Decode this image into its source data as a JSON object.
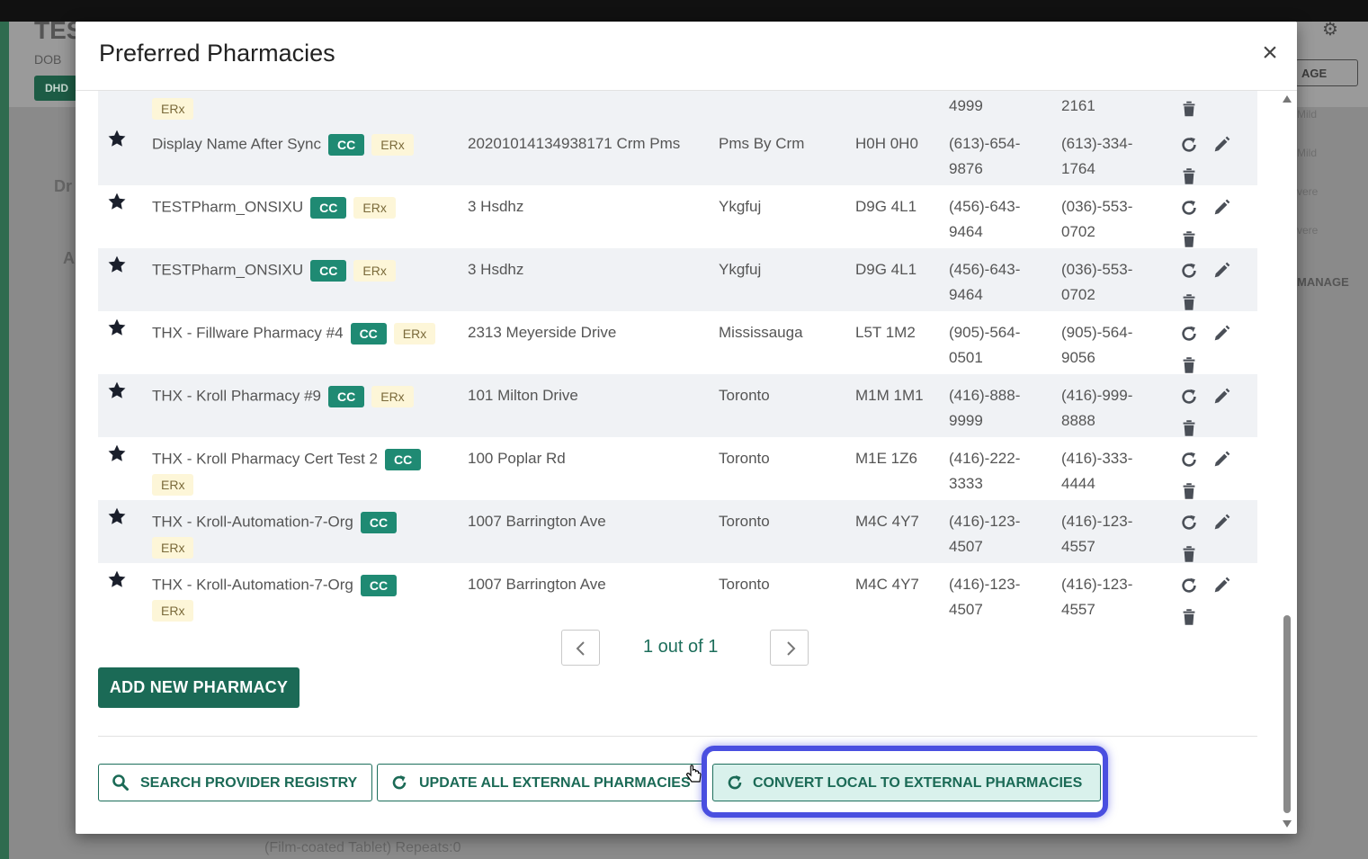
{
  "background": {
    "title": "TES",
    "dob_label": "DOB",
    "chip": "DHD",
    "manage_button": "AGE",
    "severity_labels": [
      "Mild",
      "Mild",
      "vere",
      "vere"
    ],
    "manage_label": "MANAGE",
    "left_texts": [
      "Dr",
      "A"
    ],
    "bottom_text": "(Film-coated Tablet) Repeats:0"
  },
  "modal": {
    "title": "Preferred Pharmacies",
    "close_glyph": "×"
  },
  "partial_row": {
    "erx": "ERx",
    "phone": "4999",
    "fax": "2161"
  },
  "pharmacies": [
    {
      "name": "Display Name After Sync",
      "cc": "CC",
      "erx": "ERx",
      "erx_wrapped": false,
      "address": "20201014134938171 Crm Pms",
      "city": "Pms By Crm",
      "postal": "H0H 0H0",
      "phone_a": "(613)-654-",
      "phone_b": "9876",
      "fax_a": "(613)-334-",
      "fax_b": "1764"
    },
    {
      "name": "TESTPharm_ONSIXU",
      "cc": "CC",
      "erx": "ERx",
      "erx_wrapped": false,
      "address": "3 Hsdhz",
      "city": "Ykgfuj",
      "postal": "D9G 4L1",
      "phone_a": "(456)-643-",
      "phone_b": "9464",
      "fax_a": "(036)-553-",
      "fax_b": "0702"
    },
    {
      "name": "TESTPharm_ONSIXU",
      "cc": "CC",
      "erx": "ERx",
      "erx_wrapped": false,
      "address": "3 Hsdhz",
      "city": "Ykgfuj",
      "postal": "D9G 4L1",
      "phone_a": "(456)-643-",
      "phone_b": "9464",
      "fax_a": "(036)-553-",
      "fax_b": "0702"
    },
    {
      "name": "THX - Fillware Pharmacy #4",
      "cc": "CC",
      "erx": "ERx",
      "erx_wrapped": false,
      "address": "2313 Meyerside Drive",
      "city": "Mississauga",
      "postal": "L5T 1M2",
      "phone_a": "(905)-564-",
      "phone_b": "0501",
      "fax_a": "(905)-564-",
      "fax_b": "9056"
    },
    {
      "name": "THX - Kroll Pharmacy #9",
      "cc": "CC",
      "erx": "ERx",
      "erx_wrapped": false,
      "address": "101 Milton Drive",
      "city": "Toronto",
      "postal": "M1M 1M1",
      "phone_a": "(416)-888-",
      "phone_b": "9999",
      "fax_a": "(416)-999-",
      "fax_b": "8888"
    },
    {
      "name": "THX - Kroll Pharmacy Cert Test 2",
      "cc": "CC",
      "erx": "ERx",
      "erx_wrapped": true,
      "address": "100 Poplar Rd",
      "city": "Toronto",
      "postal": "M1E 1Z6",
      "phone_a": "(416)-222-",
      "phone_b": "3333",
      "fax_a": "(416)-333-",
      "fax_b": "4444"
    },
    {
      "name": "THX - Kroll-Automation-7-Org",
      "cc": "CC",
      "erx": "ERx",
      "erx_wrapped": true,
      "address": "1007 Barrington Ave",
      "city": "Toronto",
      "postal": "M4C 4Y7",
      "phone_a": "(416)-123-",
      "phone_b": "4507",
      "fax_a": "(416)-123-",
      "fax_b": "4557"
    },
    {
      "name": "THX - Kroll-Automation-7-Org",
      "cc": "CC",
      "erx": "ERx",
      "erx_wrapped": true,
      "address": "1007 Barrington Ave",
      "city": "Toronto",
      "postal": "M4C 4Y7",
      "phone_a": "(416)-123-",
      "phone_b": "4507",
      "fax_a": "(416)-123-",
      "fax_b": "4557"
    }
  ],
  "pagination": {
    "text": "1 out of 1",
    "prev_icon": "chevron-left-icon",
    "next_icon": "chevron-right-icon"
  },
  "buttons": {
    "add_new": "ADD NEW PHARMACY",
    "search_registry": "SEARCH PROVIDER REGISTRY",
    "update_all": "UPDATE ALL EXTERNAL PHARMACIES",
    "convert_local": "CONVERT LOCAL TO EXTERNAL PHARMACIES"
  },
  "colors": {
    "primary": "#1b6a56",
    "cc_badge": "#1f8a73",
    "erx_badge_bg": "#fdf6d8",
    "highlight": "#4a4fe0"
  },
  "icons": {
    "favorite": "star-icon",
    "refresh": "refresh-icon",
    "edit": "pencil-icon",
    "delete": "trash-icon",
    "search": "search-icon"
  }
}
